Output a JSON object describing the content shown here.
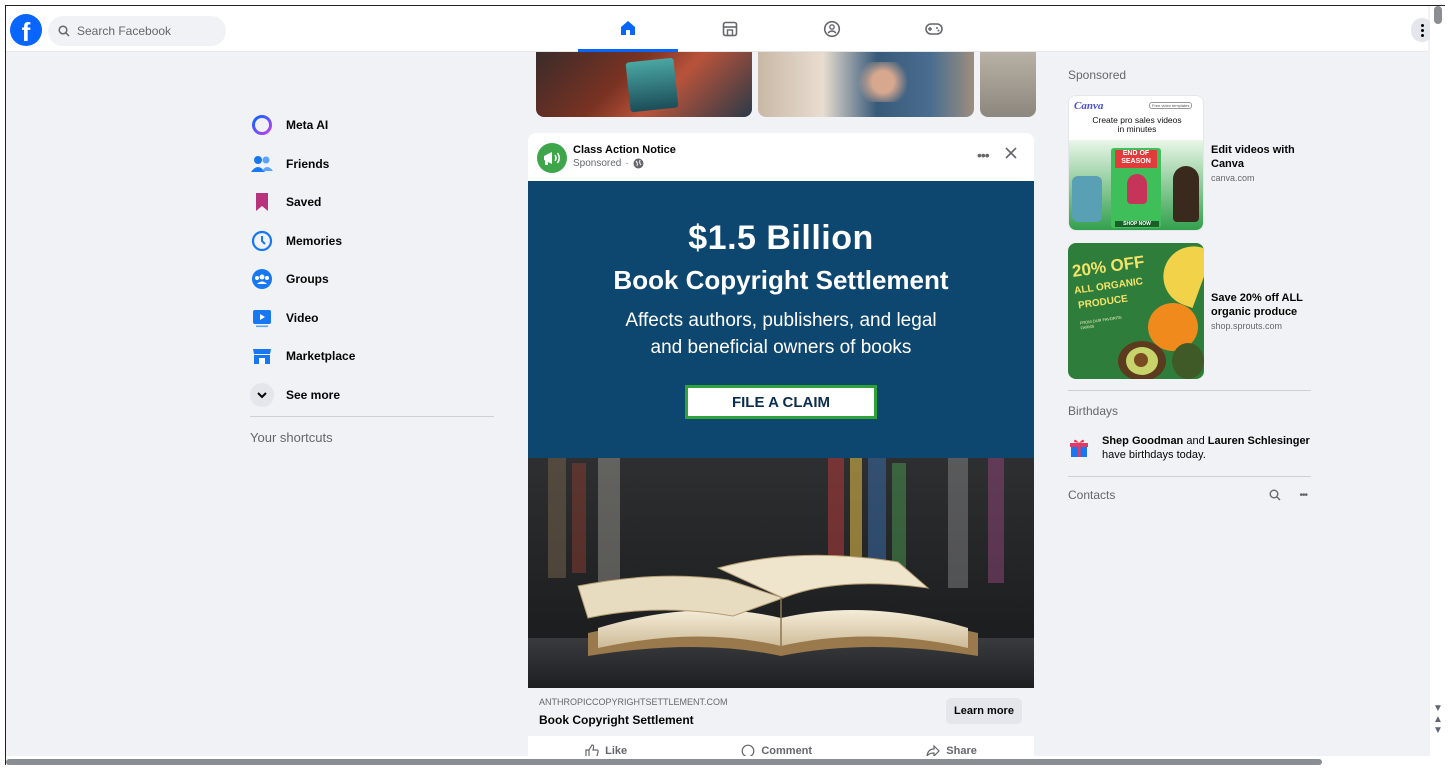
{
  "header": {
    "search_placeholder": "Search Facebook",
    "nav": [
      "home-icon",
      "marketplace-icon",
      "groups-icon",
      "gaming-icon"
    ],
    "active_nav": "home",
    "accent": "#0866ff"
  },
  "sidebar": {
    "items": [
      {
        "label": "Meta AI",
        "icon": "meta-ai-icon"
      },
      {
        "label": "Friends",
        "icon": "friends-icon"
      },
      {
        "label": "Saved",
        "icon": "saved-icon"
      },
      {
        "label": "Memories",
        "icon": "memories-icon"
      },
      {
        "label": "Groups",
        "icon": "groups-icon"
      },
      {
        "label": "Video",
        "icon": "video-icon"
      },
      {
        "label": "Marketplace",
        "icon": "marketplace-icon"
      },
      {
        "label": "See more",
        "icon": "chevron-down-icon"
      }
    ],
    "shortcuts_label": "Your shortcuts"
  },
  "post": {
    "page_name": "Class Action Notice",
    "sponsored": "Sponsored",
    "ad_headline": "$1.5 Billion",
    "ad_subheadline": "Book Copyright Settlement",
    "ad_line1": "Affects authors, publishers, and legal",
    "ad_line2": "and beneficial owners of books",
    "ad_button": "FILE A CLAIM",
    "link_domain": "ANTHROPICCOPYRIGHTSETTLEMENT.COM",
    "link_title": "Book Copyright Settlement",
    "learn_more": "Learn more",
    "actions": {
      "like": "Like",
      "comment": "Comment",
      "share": "Share"
    }
  },
  "right": {
    "sponsored_heading": "Sponsored",
    "ads": [
      {
        "title1": "Edit videos with",
        "title2": "Canva",
        "domain": "canva.com",
        "thumb_brand": "Canva",
        "thumb_badge": "Free video templates",
        "thumb_caption1": "Create pro sales videos",
        "thumb_caption2": "in minutes",
        "thumb_sign1": "END OF",
        "thumb_sign2": "SEASON",
        "thumb_sign3": "SHOP NOW"
      },
      {
        "title1": "Save 20% off ALL",
        "title2": "organic produce",
        "domain": "shop.sprouts.com",
        "thumb_big": "20% OFF",
        "thumb_line2": "ALL ORGANIC",
        "thumb_line3": "PRODUCE",
        "thumb_small": "FROM OUR FAVORITE FARMS"
      }
    ],
    "birthdays_heading": "Birthdays",
    "birthday_name1": "Shep Goodman",
    "birthday_and": " and ",
    "birthday_name2": "Lauren Schlesinger",
    "birthday_suffix": "have birthdays today.",
    "contacts_heading": "Contacts"
  }
}
